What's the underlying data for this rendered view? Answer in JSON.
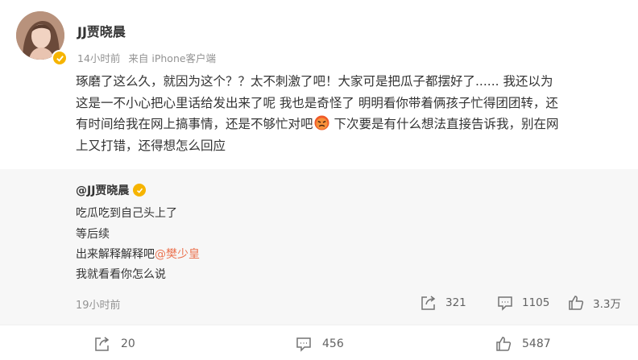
{
  "post": {
    "username": "JJ贾晓晨",
    "time": "14小时前",
    "source": "来自 iPhone客户端",
    "lines": [
      "琢磨了这么久，就因为这个？？太不刺激了吧！大家可是把瓜子都摆好了......  我还以为",
      "这是一不小心把心里话给发出来了呢 我也是奇怪了 明明看你带着俩孩子忙得团团转，还",
      "有时间给我在网上搞事情，还是不够忙对吧",
      " 下次要是有什么想法直接告诉我，别在网",
      "上又打错，还得想怎么回应"
    ]
  },
  "repost": {
    "author": "@JJ贾晓晨",
    "lines": [
      "吃瓜吃到自己头上了",
      "等后续",
      "出来解释解释吧",
      "我就看看你怎么说"
    ],
    "mention": "@樊少皇",
    "time": "19小时前",
    "reposts": "321",
    "comments": "1105",
    "likes": "3.3万"
  },
  "actions": {
    "reposts": "20",
    "comments": "456",
    "likes": "5487"
  },
  "colors": {
    "mention": "#eb7350",
    "badge": "#f6b400",
    "repost_bg": "#f7f7f7"
  },
  "icons": [
    "verified-badge-icon",
    "angry-face-emoji-icon",
    "repost-icon",
    "comment-icon",
    "like-icon"
  ]
}
